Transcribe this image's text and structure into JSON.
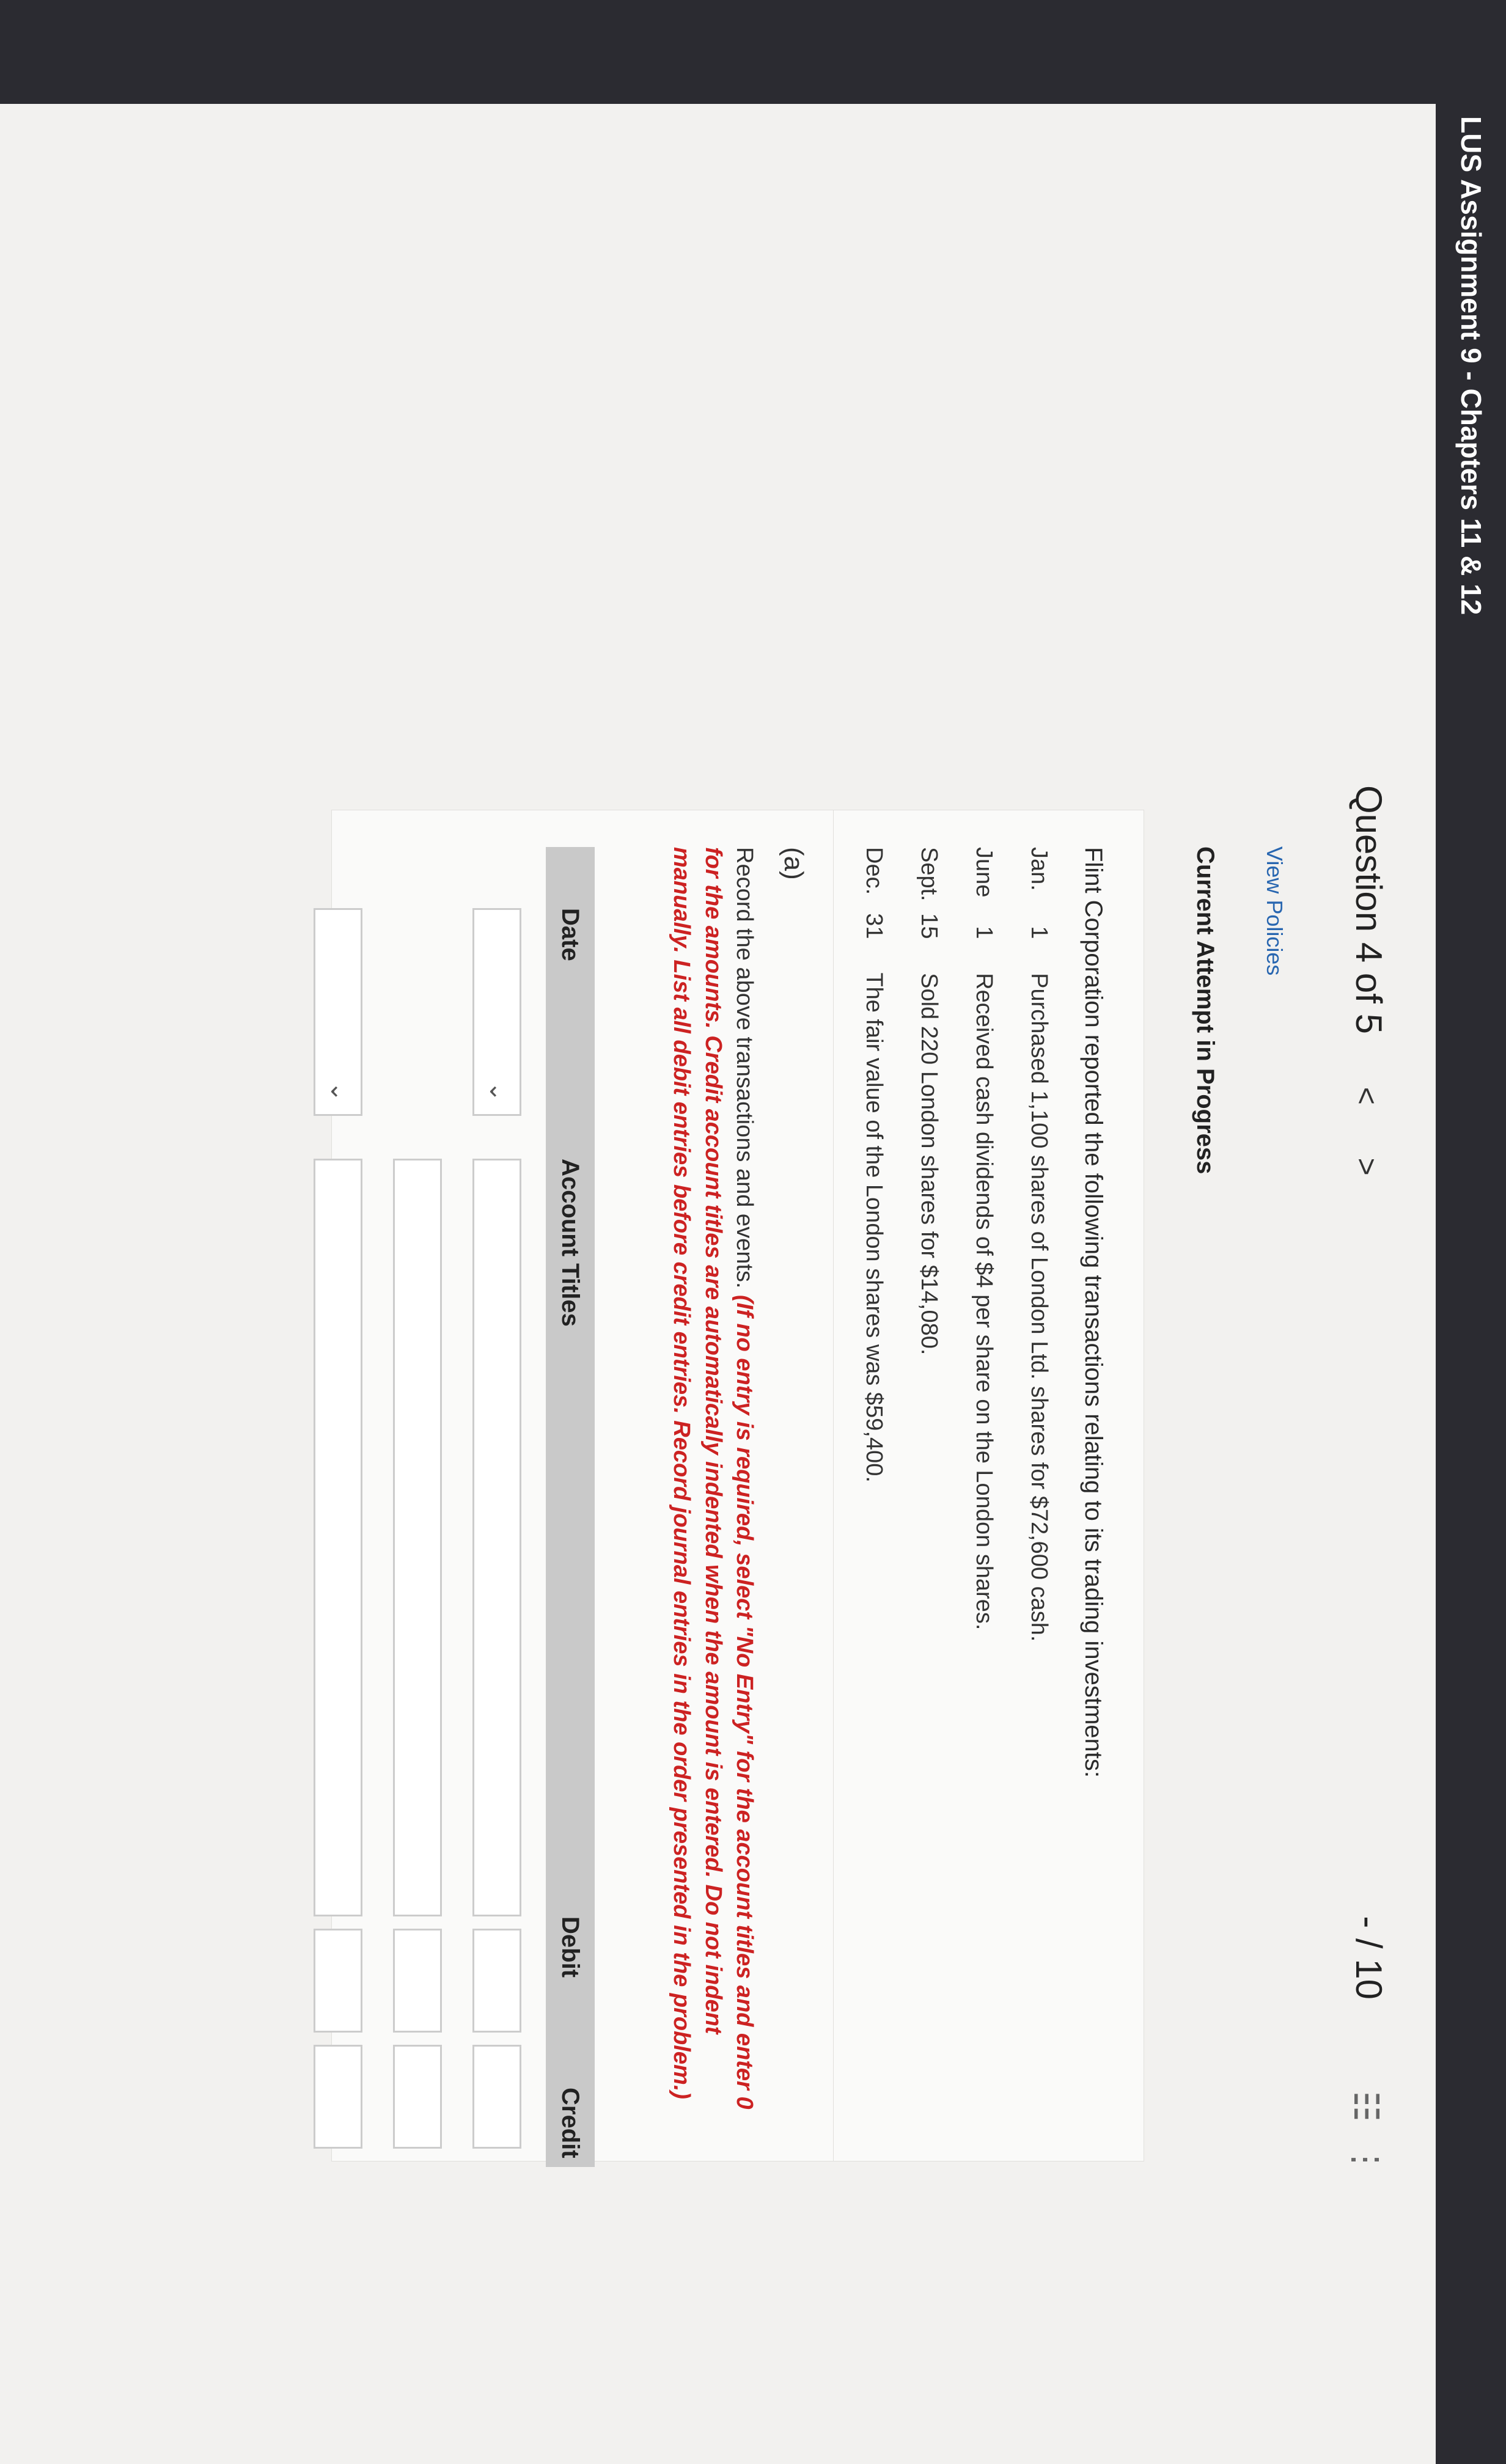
{
  "assignment_title": "LUS Assignment 9 - Chapters 11 & 12",
  "question": {
    "label": "Question 4 of 5",
    "prev": "<",
    "next": ">",
    "score": "- / 10",
    "list_icon": "list-icon",
    "more_icon": "more-icon"
  },
  "view_policies": "View Policies",
  "attempt_status": "Current Attempt in Progress",
  "problem": {
    "intro": "Flint Corporation reported the following transactions relating to its trading investments:",
    "transactions": [
      {
        "month": "Jan.",
        "day": "1",
        "text": "Purchased 1,100 shares of London Ltd. shares for $72,600 cash."
      },
      {
        "month": "June",
        "day": "1",
        "text": "Received cash dividends of $4 per share on the London shares."
      },
      {
        "month": "Sept.",
        "day": "15",
        "text": "Sold 220 London shares for $14,080."
      },
      {
        "month": "Dec.",
        "day": "31",
        "text": "The fair value of the London shares was $59,400."
      }
    ]
  },
  "part": {
    "label": "(a)",
    "instruction_plain": "Record the above transactions and events.",
    "instruction_red": "(If no entry is required, select \"No Entry\" for the account titles and enter 0 for the amounts. Credit account titles are automatically indented when the amount is entered. Do not indent manually. List all debit entries before credit entries. Record journal entries in the order presented in the problem.)"
  },
  "table": {
    "headers": {
      "date": "Date",
      "account": "Account Titles",
      "debit": "Debit",
      "credit": "Credit"
    }
  }
}
